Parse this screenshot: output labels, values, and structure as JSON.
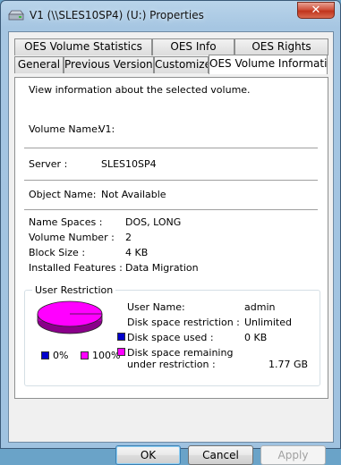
{
  "window": {
    "title": "V1 (\\\\SLES10SP4) (U:) Properties",
    "close_label": "✕"
  },
  "tabs": {
    "row1": [
      "OES Volume Statistics",
      "OES Info",
      "OES Rights"
    ],
    "row2": [
      "General",
      "Previous Versions",
      "Customize",
      "OES Volume Information"
    ],
    "active": "OES Volume Information"
  },
  "panel": {
    "intro": "View information about the selected volume.",
    "volume_name_label": "Volume Name:",
    "volume_name_value": "V1:",
    "server_label": "Server :",
    "server_value": "SLES10SP4",
    "object_name_label": "Object Name:",
    "object_name_value": "Not Available",
    "namespaces_label": "Name Spaces :",
    "namespaces_value": "DOS, LONG",
    "volume_number_label": "Volume Number :",
    "volume_number_value": "2",
    "block_size_label": "Block Size :",
    "block_size_value": "4 KB",
    "installed_features_label": "Installed Features :",
    "installed_features_value": "Data Migration"
  },
  "user_restriction": {
    "title": "User Restriction",
    "username_label": "User Name:",
    "username_value": "admin",
    "restriction_label": "Disk space restriction :",
    "restriction_value": "Unlimited",
    "used_label": "Disk space used :",
    "used_value": "0 KB",
    "remaining_label_1": "Disk space remaining",
    "remaining_label_2": "under restriction :",
    "remaining_value": "1.77 GB",
    "legend_used_pct": "0%",
    "legend_free_pct": "100%",
    "used_fraction": 0.0,
    "colors": {
      "used": "#0000cc",
      "remaining": "#ff00ff"
    }
  },
  "buttons": {
    "ok": "OK",
    "cancel": "Cancel",
    "apply": "Apply"
  }
}
